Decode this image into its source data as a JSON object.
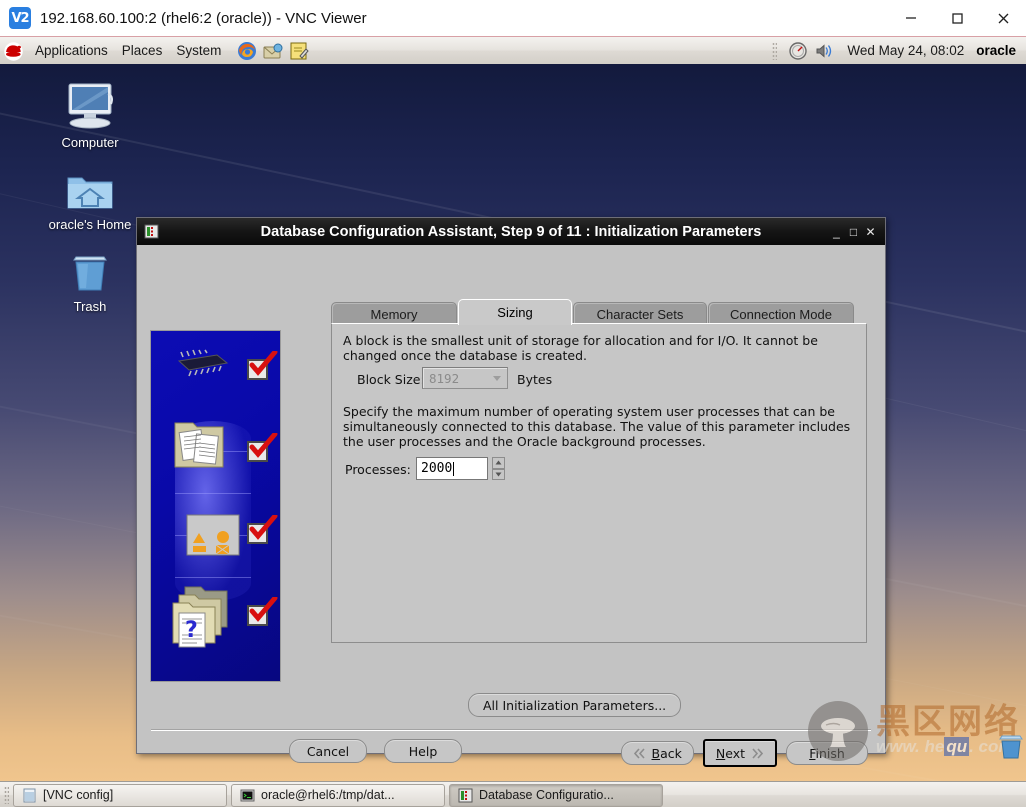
{
  "vnc_window": {
    "icon": "vnc-logo-icon",
    "icon_text": "V2",
    "title": "192.168.60.100:2 (rhel6:2 (oracle)) - VNC Viewer",
    "controls": [
      {
        "name": "minimize-button",
        "glyph": "minimize-icon"
      },
      {
        "name": "maximize-button",
        "glyph": "maximize-icon"
      },
      {
        "name": "close-button",
        "glyph": "close-icon"
      }
    ]
  },
  "gnome_panel": {
    "logo": "redhat-logo-icon",
    "menus": [
      "Applications",
      "Places",
      "System"
    ],
    "launchers": [
      "firefox-icon",
      "evolution-mail-icon",
      "text-editor-icon"
    ],
    "tray": [
      "system-monitor-icon",
      "volume-icon"
    ],
    "clock": "Wed May 24, 08:02",
    "user": "oracle"
  },
  "desktop": {
    "icons": [
      {
        "name": "computer",
        "label": "Computer",
        "icon": "computer-icon"
      },
      {
        "name": "home",
        "label": "oracle's Home",
        "icon": "home-folder-icon"
      },
      {
        "name": "trash",
        "label": "Trash",
        "icon": "trash-icon"
      }
    ]
  },
  "dialog": {
    "icon": "dbca-icon",
    "title": "Database Configuration Assistant, Step 9 of 11 : Initialization Parameters",
    "controls": [
      {
        "name": "minimize-button",
        "glyph": "_"
      },
      {
        "name": "maximize-button",
        "glyph": "□"
      },
      {
        "name": "close-button",
        "glyph": "✕"
      }
    ],
    "sidebar": {
      "name": "dbca-illustration",
      "steps": [
        {
          "icon": "cpu-chip-icon",
          "checked": true
        },
        {
          "icon": "documents-icon",
          "checked": true
        },
        {
          "icon": "shapes-panel-icon",
          "checked": true
        },
        {
          "icon": "folders-question-icon",
          "checked": true
        }
      ]
    },
    "tabs": [
      {
        "label": "Memory",
        "selected": false
      },
      {
        "label": "Sizing",
        "selected": true
      },
      {
        "label": "Character Sets",
        "selected": false
      },
      {
        "label": "Connection Mode",
        "selected": false
      }
    ],
    "sizing_panel": {
      "block_paragraph": "A block is the smallest unit of storage for allocation and for I/O. It cannot be changed once the database is created.",
      "block_size_label": "Block Size:",
      "block_size_value": "8192",
      "block_size_unit": "Bytes",
      "block_size_enabled": false,
      "processes_paragraph": "Specify the maximum number of operating system user processes that can be simultaneously connected to this database. The value of this parameter includes the user processes and the Oracle background processes.",
      "processes_label": "Processes:",
      "processes_value": "2000"
    },
    "all_params_button": "All Initialization Parameters...",
    "buttons": {
      "cancel": "Cancel",
      "help": "Help",
      "back": "Back",
      "back_mnemonic": "B",
      "next": "Next",
      "next_mnemonic": "N",
      "finish": "Finish",
      "finish_mnemonic": "F",
      "focused": "next"
    }
  },
  "taskbar": {
    "items": [
      {
        "label": "[VNC config]",
        "icon": "window-icon",
        "active": false
      },
      {
        "label": "oracle@rhel6:/tmp/dat...",
        "icon": "terminal-icon",
        "active": false
      },
      {
        "label": "Database Configuratio...",
        "icon": "dbca-icon",
        "active": true
      }
    ]
  },
  "watermark": {
    "logo": "mushroom-logo-icon",
    "chinese": "黑区网络",
    "url_pre": "www. he",
    "url_hl": "qu",
    "url_post": ". com"
  },
  "colors": {
    "dialog_bg": "#c3c3c3",
    "titlebar": "#111111",
    "tab_selected": "#c9c9c9",
    "tab_normal": "#9d9d9d",
    "sidebar_blue": "#0a0aa8",
    "check_red": "#d81010"
  }
}
